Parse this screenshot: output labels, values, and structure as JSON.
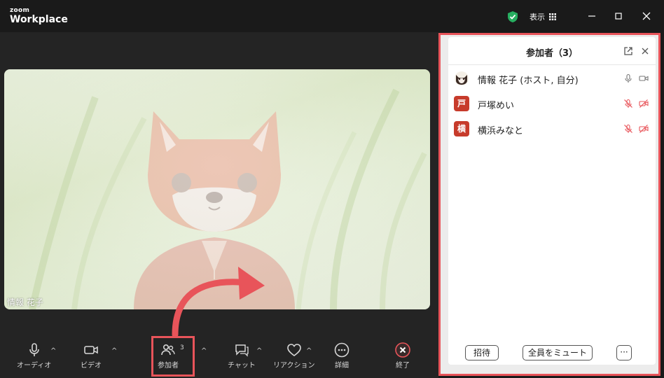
{
  "titlebar": {
    "brand_small": "zoom",
    "brand_big": "Workplace",
    "view_label": "表示",
    "icons": [
      "shield-check-icon",
      "grid-icon",
      "minimize-icon",
      "maximize-icon",
      "close-icon"
    ],
    "shield_color": "#27ae60"
  },
  "video": {
    "participant_name": "情報 花子"
  },
  "toolbar": {
    "items": [
      {
        "label": "オーディオ",
        "icon": "microphone-icon"
      },
      {
        "label": "ビデオ",
        "icon": "video-camera-icon"
      },
      {
        "label": "参加者",
        "icon": "participants-icon",
        "badge": "3"
      },
      {
        "label": "チャット",
        "icon": "chat-icon"
      },
      {
        "label": "リアクション",
        "icon": "heart-icon"
      },
      {
        "label": "詳細",
        "icon": "more-icon"
      },
      {
        "label": "終了",
        "icon": "end-icon"
      }
    ],
    "end_color": "#e8545a"
  },
  "panel": {
    "title": "参加者（3）",
    "participants": [
      {
        "name": "情報 花子 (ホスト, 自分)",
        "avatar": "",
        "muted": false
      },
      {
        "name": "戸塚めい",
        "avatar": "戸",
        "muted": true
      },
      {
        "name": "横浜みなと",
        "avatar": "横",
        "muted": true
      }
    ],
    "invite_label": "招待",
    "mute_all_label": "全員をミュート",
    "more_label": "···",
    "accent_color": "#e8545a",
    "avatar_color": "#c73b2b"
  }
}
